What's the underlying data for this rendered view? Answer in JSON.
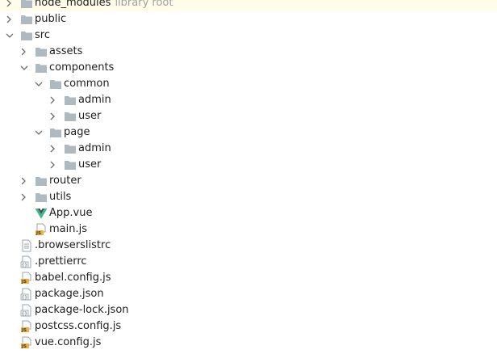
{
  "project_tree": {
    "items": [
      {
        "label": "node_modules",
        "hint": "library root",
        "type": "folder",
        "state": "collapsed"
      },
      {
        "label": "public",
        "type": "folder",
        "state": "collapsed"
      },
      {
        "label": "src",
        "type": "folder",
        "state": "expanded"
      },
      {
        "label": "assets",
        "type": "folder",
        "state": "collapsed"
      },
      {
        "label": "components",
        "type": "folder",
        "state": "expanded"
      },
      {
        "label": "common",
        "type": "folder",
        "state": "expanded"
      },
      {
        "label": "admin",
        "type": "folder",
        "state": "collapsed"
      },
      {
        "label": "user",
        "type": "folder",
        "state": "collapsed"
      },
      {
        "label": "page",
        "type": "folder",
        "state": "expanded"
      },
      {
        "label": "admin",
        "type": "folder",
        "state": "collapsed"
      },
      {
        "label": "user",
        "type": "folder",
        "state": "collapsed"
      },
      {
        "label": "router",
        "type": "folder",
        "state": "collapsed"
      },
      {
        "label": "utils",
        "type": "folder",
        "state": "collapsed"
      },
      {
        "label": "App.vue",
        "type": "vue-file"
      },
      {
        "label": "main.js",
        "type": "js-file"
      },
      {
        "label": ".browserslistrc",
        "type": "text-file"
      },
      {
        "label": ".prettierrc",
        "type": "config-file"
      },
      {
        "label": "babel.config.js",
        "type": "js-file"
      },
      {
        "label": "package.json",
        "type": "json-file"
      },
      {
        "label": "package-lock.json",
        "type": "json-file"
      },
      {
        "label": "postcss.config.js",
        "type": "js-file"
      },
      {
        "label": "vue.config.js",
        "type": "js-file"
      }
    ]
  },
  "colors": {
    "folder": "#aeb9c0",
    "chevron": "#6e6e6e",
    "js_badge": "#f4af3d",
    "vue_green": "#41b883",
    "vue_dark": "#35495e",
    "selected_row": "#fffde9",
    "hint_text": "#a0a0a0"
  },
  "icons": {
    "folder": "folder-icon",
    "vue-file": "vue-file-icon",
    "js-file": "js-file-icon",
    "json-file": "json-file-icon",
    "config-file": "config-file-icon",
    "text-file": "text-file-icon",
    "collapsed": "chevron-right-icon",
    "expanded": "chevron-down-icon"
  }
}
